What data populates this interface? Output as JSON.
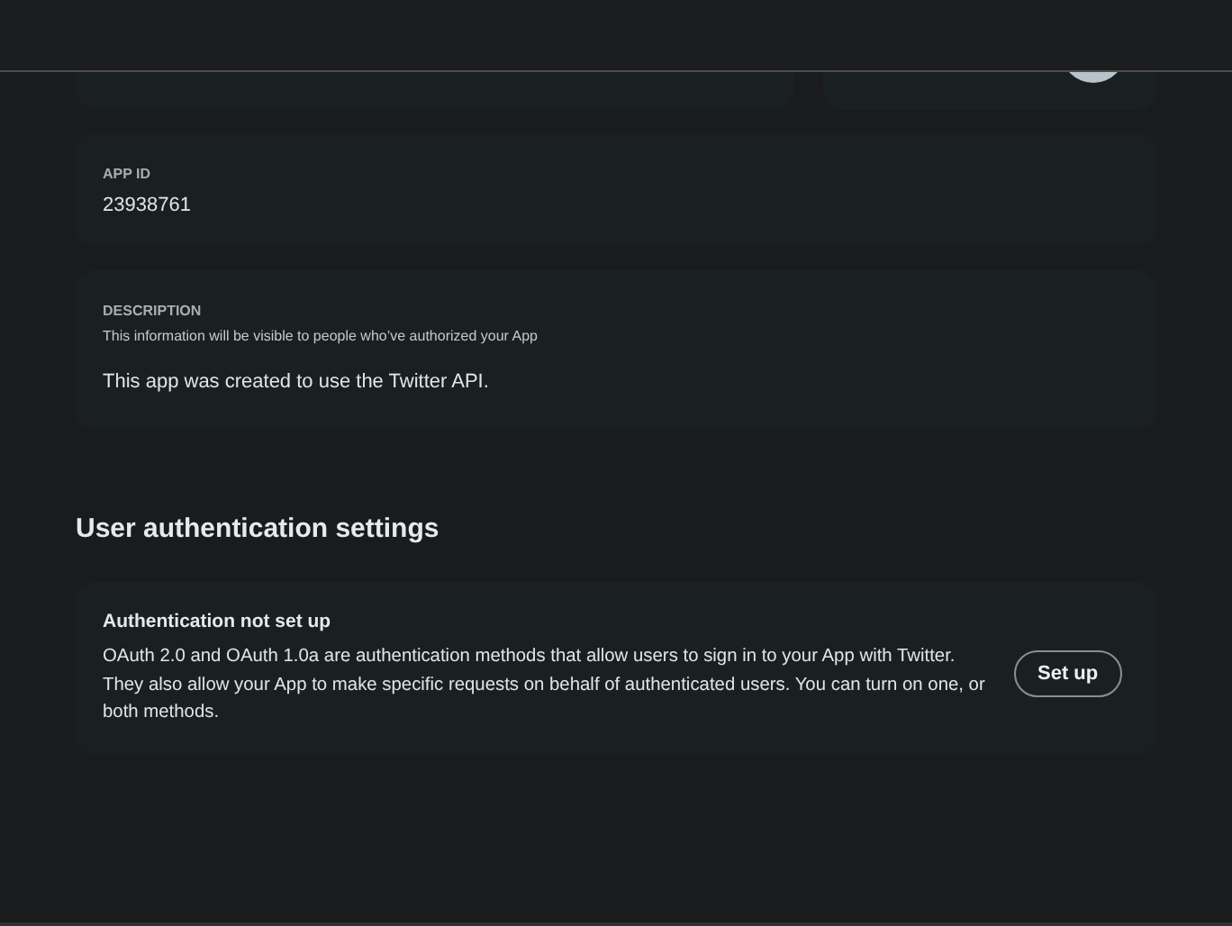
{
  "app_id": {
    "label": "APP ID",
    "value": "23938761"
  },
  "description": {
    "label": "DESCRIPTION",
    "hint": "This information will be visible to people who’ve authorized your App",
    "value": "This app was created to use the Twitter API."
  },
  "user_auth": {
    "heading": "User authentication settings",
    "title": "Authentication not set up",
    "text": "OAuth 2.0 and OAuth 1.0a are authentication methods that allow users to sign in to your App with Twitter. They also allow your App to make specific requests on behalf of authenticated users. You can turn on one, or both methods.",
    "button": "Set up"
  }
}
